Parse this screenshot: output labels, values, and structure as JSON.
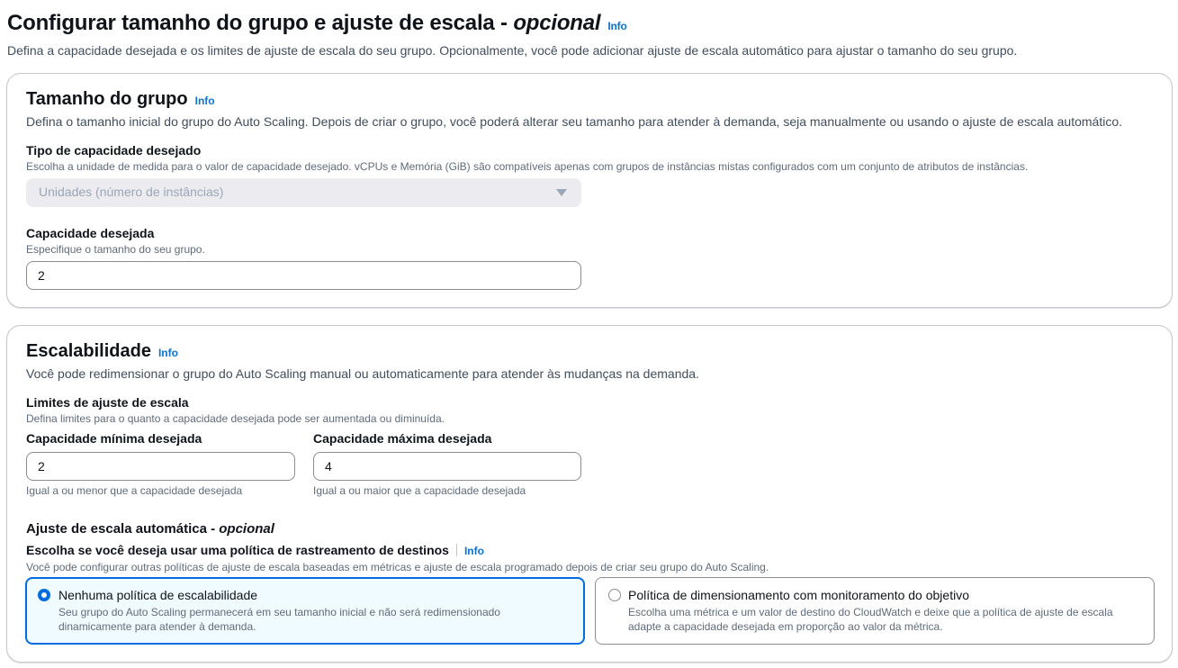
{
  "header": {
    "title": "Configurar tamanho do grupo e ajuste de escala - ",
    "title_optional": "opcional",
    "info": "Info",
    "description": "Defina a capacidade desejada e os limites de ajuste de escala do seu grupo. Opcionalmente, você pode adicionar ajuste de escala automático para ajustar o tamanho do seu grupo."
  },
  "group_size": {
    "title": "Tamanho do grupo",
    "info": "Info",
    "description": "Defina o tamanho inicial do grupo do Auto Scaling. Depois de criar o grupo, você poderá alterar seu tamanho para atender à demanda, seja manualmente ou usando o ajuste de escala automático.",
    "capacity_type": {
      "label": "Tipo de capacidade desejado",
      "hint": "Escolha a unidade de medida para o valor de capacidade desejado. vCPUs e Memória (GiB) são compatíveis apenas com grupos de instâncias mistas configurados com um conjunto de atributos de instâncias.",
      "selected": "Unidades (número de instâncias)"
    },
    "desired_capacity": {
      "label": "Capacidade desejada",
      "hint": "Especifique o tamanho do seu grupo.",
      "value": "2"
    }
  },
  "scalability": {
    "title": "Escalabilidade",
    "info": "Info",
    "description": "Você pode redimensionar o grupo do Auto Scaling manual ou automaticamente para atender às mudanças na demanda.",
    "limits": {
      "label": "Limites de ajuste de escala",
      "hint": "Defina limites para o quanto a capacidade desejada pode ser aumentada ou diminuída.",
      "min": {
        "label": "Capacidade mínima desejada",
        "value": "2",
        "hint": "Igual a ou menor que a capacidade desejada"
      },
      "max": {
        "label": "Capacidade máxima desejada",
        "value": "4",
        "hint": "Igual a ou maior que a capacidade desejada"
      }
    },
    "auto_scaling": {
      "label": "Ajuste de escala automática - ",
      "label_optional": "opcional",
      "policy_label": "Escolha se você deseja usar uma política de rastreamento de destinos",
      "info": "Info",
      "hint": "Você pode configurar outras políticas de ajuste de escala baseadas em métricas e ajuste de escala programado depois de criar seu grupo do Auto Scaling.",
      "options": [
        {
          "title": "Nenhuma política de escalabilidade",
          "description": "Seu grupo do Auto Scaling permanecerá em seu tamanho inicial e não será redimensionado dinamicamente para atender à demanda.",
          "selected": true
        },
        {
          "title": "Política de dimensionamento com monitoramento do objetivo",
          "description": "Escolha uma métrica e um valor de destino do CloudWatch e deixe que a política de ajuste de escala adapte a capacidade desejada em proporção ao valor da métrica.",
          "selected": false
        }
      ]
    }
  },
  "colors": {
    "accent": "#006ce0",
    "link": "#0972d3",
    "selected_tile_bg": "#f0fbff"
  }
}
